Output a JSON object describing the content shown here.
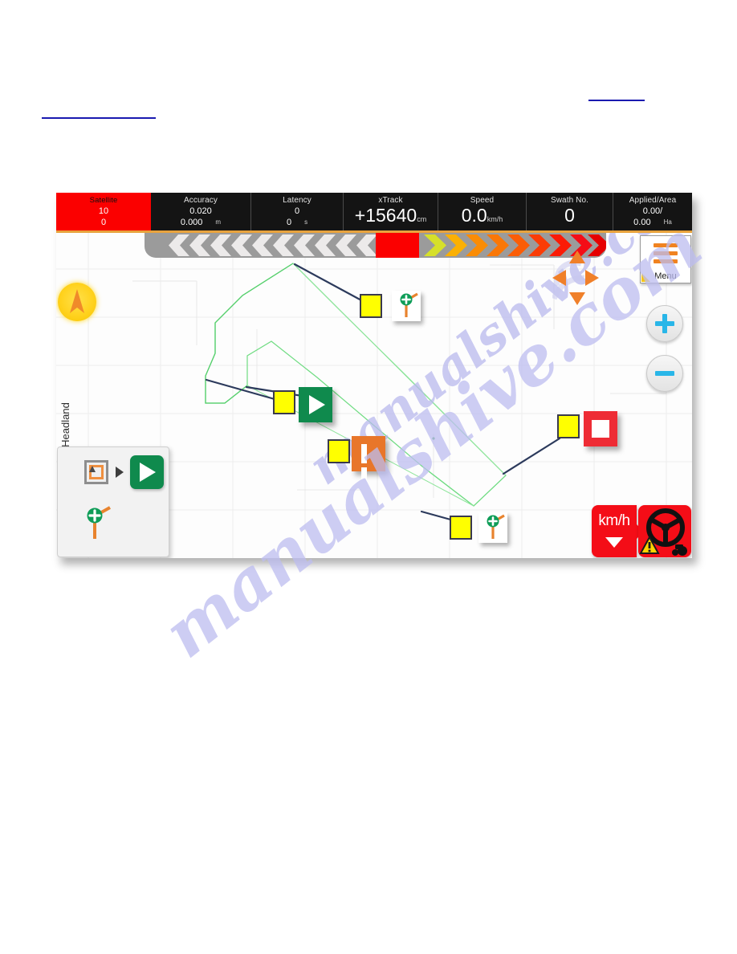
{
  "document": {
    "link_left": "",
    "link_right": ""
  },
  "watermark": {
    "line1": "manualshive.com",
    "line2": "manualshive.com"
  },
  "statusbar": {
    "satellite": {
      "label": "Satellite",
      "value1": "10",
      "value2": "0"
    },
    "accuracy": {
      "label": "Accuracy",
      "value1": "0.020",
      "value2": "0.000",
      "unit": "m"
    },
    "latency": {
      "label": "Latency",
      "value1": "0",
      "value2": "0",
      "unit": "s"
    },
    "xtrack": {
      "label": "xTrack",
      "value": "+15640",
      "unit": "cm"
    },
    "speed": {
      "label": "Speed",
      "value": "0.0",
      "unit": "km/h"
    },
    "swath": {
      "label": "Swath No.",
      "value": "0"
    },
    "applied": {
      "label": "Applied/Area",
      "value1": "0.00/",
      "value2": "0.00",
      "unit": "Ha"
    }
  },
  "lightbar": {
    "left_chevron_color": "#eceaea",
    "center_color": "#fb0000",
    "track_color": "#9b9b9b",
    "right_chevrons": [
      "#d6e02a",
      "#fbb003",
      "#fa8c05",
      "#fa7706",
      "#fb5d06",
      "#fb3c06",
      "#fb1b06",
      "#f40d17",
      "#e60000"
    ],
    "left_chevron_count": 11
  },
  "map": {
    "north_indicator": "north-arrow",
    "field_boundary_color": "#7fe08a",
    "leader_line_color": "#2c3a5c",
    "grid_color": "#ececec"
  },
  "menu_button": {
    "label": "Menu",
    "icon": "hamburger-icon",
    "accent": "#f08321"
  },
  "pan_control": {
    "icon": "pan-arrows",
    "color": "#f0802a"
  },
  "zoom_controls": {
    "zoom_in_label": "+",
    "zoom_out_label": "−",
    "accent": "#29b6e8"
  },
  "callouts": [
    {
      "id": "callout-section-top",
      "marker": "yellow-square",
      "icon": "section-boom-icon"
    },
    {
      "id": "callout-start",
      "marker": "yellow-square",
      "icon": "play-icon",
      "color": "#0f8a4d"
    },
    {
      "id": "callout-pause",
      "marker": "yellow-square",
      "icon": "pause-icon",
      "color": "#e8762a"
    },
    {
      "id": "callout-stop",
      "marker": "yellow-square",
      "icon": "stop-icon",
      "color": "#ee2c35"
    },
    {
      "id": "callout-section-bottom",
      "marker": "yellow-square",
      "icon": "section-boom-icon"
    }
  ],
  "headland_panel": {
    "label": "Headland",
    "field_icon": "field-boundary-icon",
    "arrow_icon": "arrow-right-icon",
    "play_icon": "play-icon",
    "section_icon": "section-boom-icon"
  },
  "bottom_bar": {
    "speed_button": {
      "label": "km/h",
      "icon": "triangle-down-icon",
      "color": "#f40d17"
    },
    "steering_button": {
      "icon": "steering-wheel-icon",
      "warning_icon": "warning-triangle-icon",
      "vehicle_icon": "tractor-icon",
      "color": "#f40d17"
    }
  }
}
